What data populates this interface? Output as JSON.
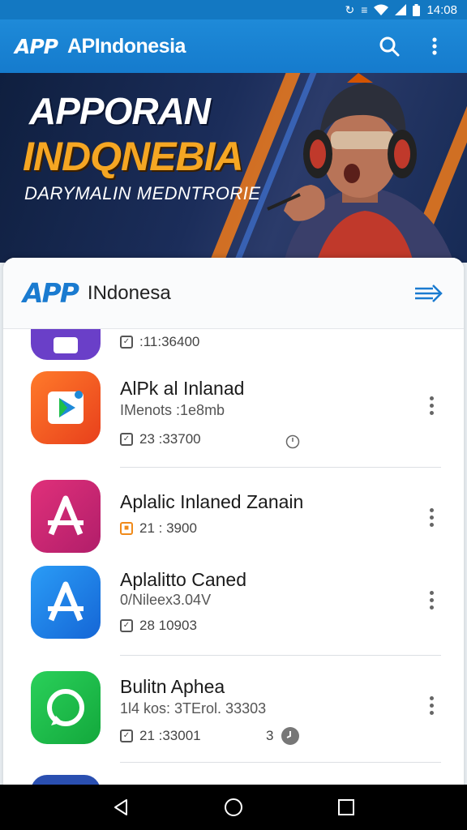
{
  "status_bar": {
    "time": "14:08"
  },
  "app_bar": {
    "logo": "APP",
    "title": "APIndonesia"
  },
  "banner": {
    "title_line1": "APPORAN",
    "title_line2": "INDQNEBIA",
    "subtitle": "DARYMALIN MEDNTRORIE"
  },
  "card": {
    "logo": "APP",
    "title": "INdonesa"
  },
  "items": [
    {
      "name": "",
      "meta": "",
      "stat": ":11:36400",
      "icon": "purple-app-icon",
      "color": "#6a3fc8"
    },
    {
      "name": "AlPk al Inlanad",
      "meta": "IMenots :1e8mb",
      "stat": "23 :33700",
      "icon": "play-store-icon",
      "color": "#f05a28"
    },
    {
      "name": "Aplalic Inlaned Zanain",
      "meta": "",
      "stat": "21 : 3900",
      "icon": "letter-a-icon",
      "color": "#c2247a"
    },
    {
      "name": "Aplalitto Caned",
      "meta": "0/Nileex3.04V",
      "stat": "28 10903",
      "icon": "app-store-icon",
      "color": "#1f7fe6"
    },
    {
      "name": "Bulitn Aphea",
      "meta": "1l4 kos: 3TErol. 33303",
      "stat": "21 :33001",
      "stat_extra": "3",
      "icon": "chat-bubble-icon",
      "color": "#1fbf4a"
    }
  ],
  "colors": {
    "primary": "#1e8ad8",
    "accent": "#f5a623"
  }
}
